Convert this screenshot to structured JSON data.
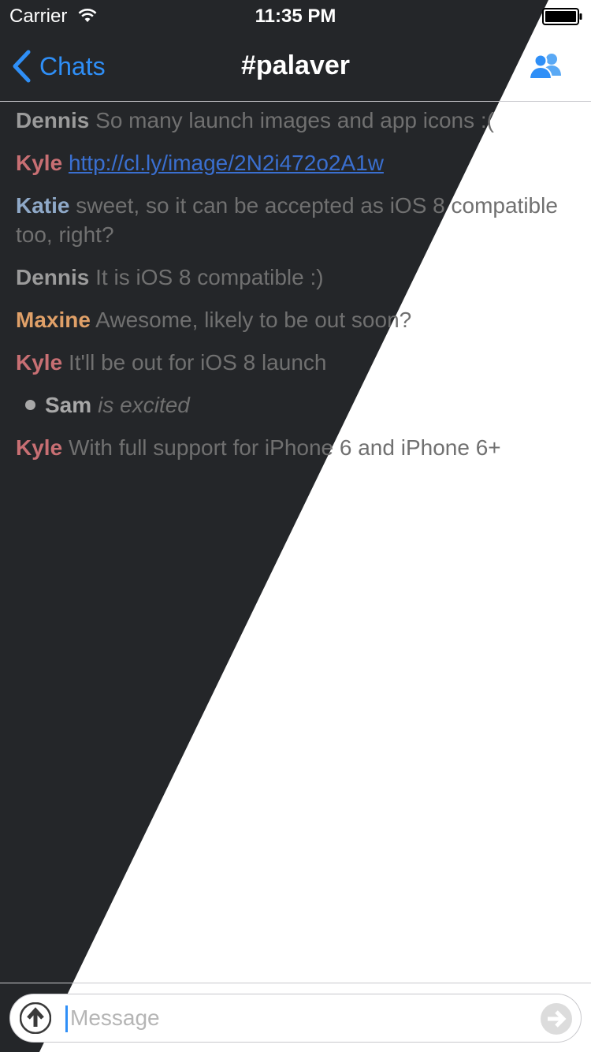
{
  "status_bar": {
    "carrier": "Carrier",
    "time": "11:35 PM"
  },
  "nav": {
    "back_label": "Chats",
    "title": "#palaver"
  },
  "colors": {
    "accent": "#2f8ff7",
    "dark_panel": "#242629",
    "nick_dennis": "#9b9b9b",
    "nick_kyle": "#c86f73",
    "nick_katie": "#8fa9c8",
    "nick_maxine": "#e0a068",
    "nick_sam": "#a8a8a8",
    "link": "#3a6fd0"
  },
  "messages": [
    {
      "type": "message",
      "nick": "Dennis",
      "text": "So many launch images and app icons :("
    },
    {
      "type": "link",
      "nick": "Kyle",
      "text": "http://cl.ly/image/2N2i472o2A1w"
    },
    {
      "type": "message",
      "nick": "Katie",
      "text": "sweet, so it can be accepted as iOS 8 compatible too, right?"
    },
    {
      "type": "message",
      "nick": "Dennis",
      "text": "It is iOS 8 compatible :)"
    },
    {
      "type": "message",
      "nick": "Maxine",
      "text": "Awesome, likely to be out soon?"
    },
    {
      "type": "message",
      "nick": "Kyle",
      "text": "It'll be out for iOS 8 launch"
    },
    {
      "type": "action",
      "nick": "Sam",
      "text": "is excited"
    },
    {
      "type": "message",
      "nick": "Kyle",
      "text": "With full support for iPhone 6 and iPhone 6+"
    }
  ],
  "composer": {
    "placeholder": "Message"
  },
  "icons": {
    "wifi": "wifi-icon",
    "battery": "battery-icon",
    "back": "chevron-left-icon",
    "members": "members-icon",
    "upload": "upload-icon",
    "send": "send-icon"
  }
}
